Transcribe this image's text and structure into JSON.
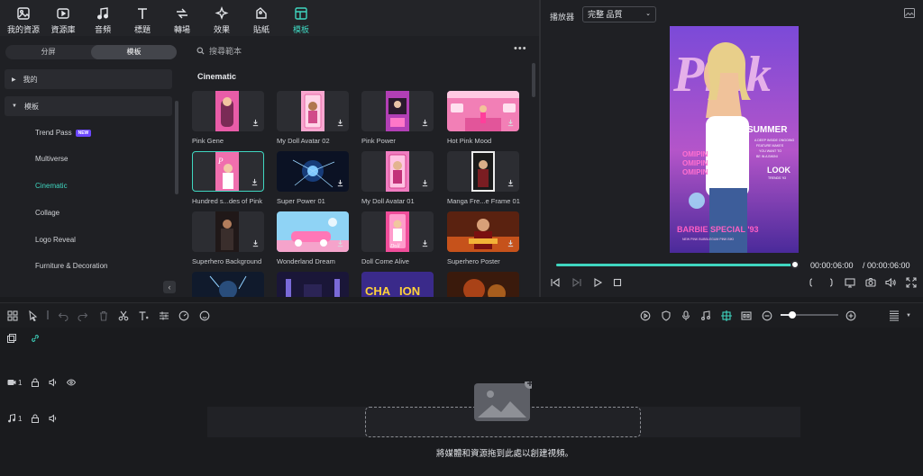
{
  "toolbar": {
    "items": [
      {
        "label": "我的資源",
        "icon": "my-media-icon"
      },
      {
        "label": "資源庫",
        "icon": "stock-media-icon"
      },
      {
        "label": "音頻",
        "icon": "audio-icon"
      },
      {
        "label": "標題",
        "icon": "titles-icon"
      },
      {
        "label": "轉場",
        "icon": "transitions-icon"
      },
      {
        "label": "效果",
        "icon": "effects-icon"
      },
      {
        "label": "貼紙",
        "icon": "stickers-icon"
      },
      {
        "label": "模板",
        "icon": "templates-icon",
        "active": true
      }
    ],
    "accent": "#3fd6c0"
  },
  "sidebar": {
    "segments": [
      "分屏",
      "模板"
    ],
    "tree": [
      {
        "label": "我的",
        "expanded": false
      },
      {
        "label": "模板",
        "expanded": true
      }
    ],
    "sub_items": [
      {
        "label": "Trend Pass",
        "badge": "NEW"
      },
      {
        "label": "Multiverse"
      },
      {
        "label": "Cinematic",
        "selected": true
      },
      {
        "label": "Collage"
      },
      {
        "label": "Logo Reveal"
      },
      {
        "label": "Furniture & Decoration"
      }
    ]
  },
  "templates": {
    "search_placeholder": "搜尋範本",
    "section": "Cinematic",
    "cards": [
      {
        "name": "Pink Gene"
      },
      {
        "name": "My Doll Avatar 02"
      },
      {
        "name": "Pink Power"
      },
      {
        "name": "Hot Pink Mood"
      },
      {
        "name": "Hundred s...des of Pink",
        "selected": true
      },
      {
        "name": "Super Power 01"
      },
      {
        "name": "My Doll Avatar 01"
      },
      {
        "name": "Manga Fre...e Frame 01"
      },
      {
        "name": "Superhero Background"
      },
      {
        "name": "Wonderland Dream"
      },
      {
        "name": "Doll Come Alive"
      },
      {
        "name": "Superhero Poster"
      }
    ]
  },
  "player": {
    "label": "播放器",
    "quality": "完整 品質",
    "current_time": "00:00:06:00",
    "total_time": "/ 00:00:06:00",
    "progress": 1.0,
    "poster": {
      "title": "Pink",
      "headline": "SUMMER",
      "blurb": [
        "A DEEP INSIDE ONGOING",
        "FEATURE MAKES",
        "YOU WANT TO",
        "BE IN A BIKINI"
      ],
      "side_words": [
        "OMIPIN",
        "OMIPIN",
        "OMIPIN"
      ],
      "look": "LOOK",
      "look_sub": "TRENDS '93",
      "special": "BARBIE SPECIAL '93",
      "bottom_line": "NEW PINK BUBBLEGUM PINK BIKI"
    }
  },
  "timeline": {
    "zoom": 0.2,
    "tracks": [
      {
        "num": "1",
        "type": "video"
      },
      {
        "num": "1",
        "type": "audio"
      }
    ],
    "drop_hint": "將媒體和資源拖到此處以創建視頻。"
  }
}
